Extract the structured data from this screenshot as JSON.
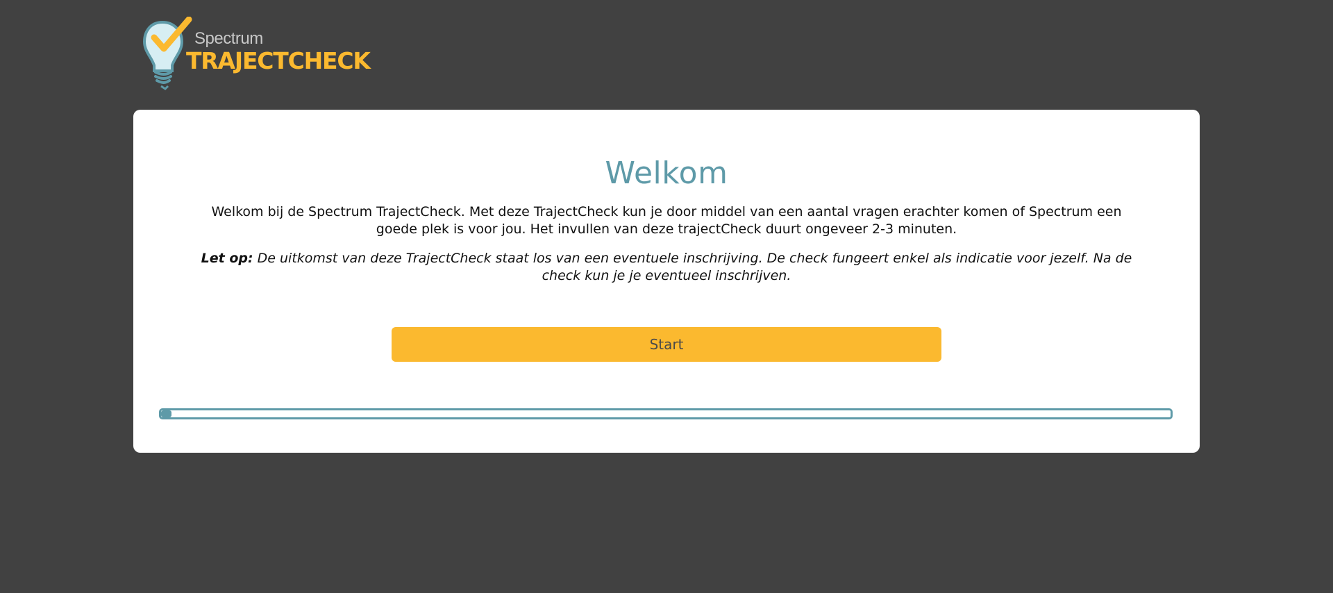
{
  "logo": {
    "small_text": "Spectrum",
    "big_text": "TRAJECTCHECK"
  },
  "main": {
    "title": "Welkom",
    "intro": "Welkom bij de Spectrum TrajectCheck. Met deze TrajectCheck kun je door middel van een aantal vragen erachter komen of Spectrum een goede plek is voor jou. Het invullen van deze trajectCheck duurt ongeveer 2-3 minuten.",
    "note_label": "Let op:",
    "note_text": " De uitkomst van deze TrajectCheck staat los van een eventuele inschrijving. De check fungeert enkel als indicatie voor jezelf. Na de check kun je je eventueel inschrijven.",
    "start_label": "Start",
    "progress_fraction": 0.01
  },
  "colors": {
    "background": "#414141",
    "accent": "#fbb92f",
    "teal": "#5e9aa8"
  },
  "icons": {
    "logo": "lightbulb-checkmark-icon"
  }
}
